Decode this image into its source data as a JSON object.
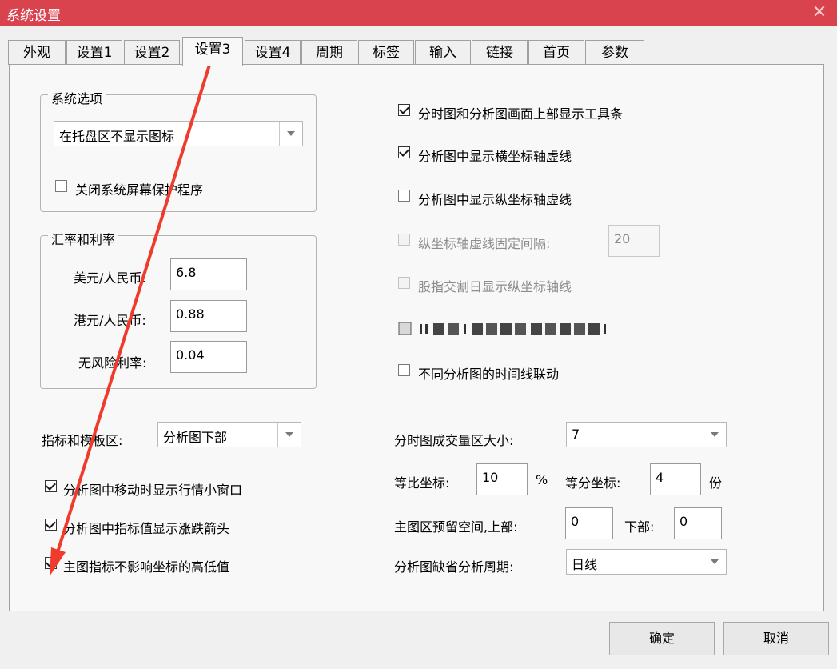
{
  "window": {
    "title": "系统设置",
    "close_label": "✕"
  },
  "tabs": [
    "外观",
    "设置1",
    "设置2",
    "设置3",
    "设置4",
    "周期",
    "标签",
    "输入",
    "链接",
    "首页",
    "参数"
  ],
  "system_options": {
    "group_label": "系统选项",
    "tray_select": "在托盘区不显示图标",
    "close_screensaver": "关闭系统屏幕保护程序"
  },
  "exchange": {
    "group_label": "汇率和利率",
    "usd_label": "美元/人民币:",
    "usd_value": "6.8",
    "hkd_label": "港元/人民币:",
    "hkd_value": "0.88",
    "rf_label": "无风险利率:",
    "rf_value": "0.04"
  },
  "indicator_area": {
    "label": "指标和模板区:",
    "value": "分析图下部"
  },
  "left_checks": [
    "分析图中移动时显示行情小窗口",
    "分析图中指标值显示涨跌箭头",
    "主图指标不影响坐标的高低值"
  ],
  "right_checks": {
    "toolbar": "分时图和分析图画面上部显示工具条",
    "hgrid": "分析图中显示横坐标轴虚线",
    "vgrid": "分析图中显示纵坐标轴虚线",
    "fixed_interval": "纵坐标轴虚线固定间隔:",
    "fixed_interval_value": "20",
    "index_split": "股指交割日显示纵坐标轴线",
    "timeline_link": "不同分析图的时间线联动"
  },
  "volume_area": {
    "label": "分时图成交量区大小:",
    "value": "7"
  },
  "ratio": {
    "label": "等比坐标:",
    "value": "10",
    "unit": "%",
    "equal_label": "等分坐标:",
    "equal_value": "4",
    "equal_unit": "份"
  },
  "reserve": {
    "label": "主图区预留空间,上部:",
    "top_value": "0",
    "bottom_label": "下部:",
    "bottom_value": "0"
  },
  "default_period": {
    "label": "分析图缺省分析周期:",
    "value": "日线"
  },
  "buttons": {
    "ok": "确定",
    "cancel": "取消"
  },
  "colors": {
    "titlebar": "#d9434e",
    "annotation_arrow": "#ef3b2c"
  }
}
